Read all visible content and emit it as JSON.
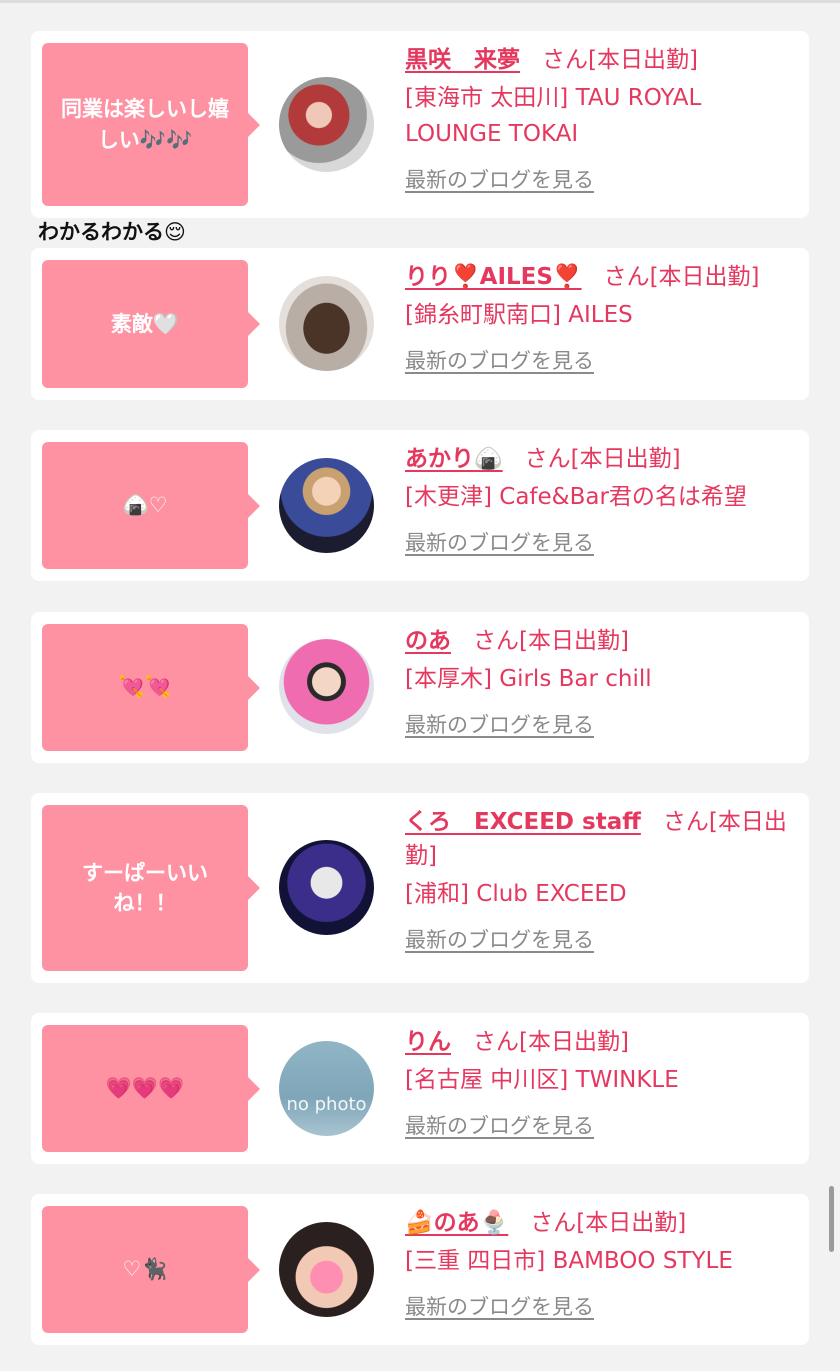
{
  "cards": [
    {
      "message": "同業は楽しいし嬉しい🎶🎶",
      "name": "黒咲　来夢",
      "suffix": "さん[本日出勤]",
      "location": "[東海市 太田川] TAU ROYAL LOUNGE TOKAI",
      "blog_link": "最新のブログを見る"
    },
    {
      "message": "素敵🤍",
      "name": "りり❣️AILES❣️",
      "suffix": "さん[本日出勤]",
      "location": "[錦糸町駅南口] AILES",
      "blog_link": "最新のブログを見る"
    },
    {
      "message": "🍙♡",
      "name": "あかり🍙",
      "suffix": "さん[本日出勤]",
      "location": "[木更津] Cafe&Bar君の名は希望",
      "blog_link": "最新のブログを見る"
    },
    {
      "message": "💘💘",
      "name": "のあ",
      "suffix": "さん[本日出勤]",
      "location": "[本厚木] Girls Bar chill",
      "blog_link": "最新のブログを見る"
    },
    {
      "message": "すーぱーいいね！！",
      "name": "くろ　EXCEED staff",
      "suffix": "さん[本日出勤]",
      "location": "[浦和] Club EXCEED",
      "blog_link": "最新のブログを見る"
    },
    {
      "message": "💗💗💗",
      "name": "りん",
      "suffix": "さん[本日出勤]",
      "location": "[名古屋 中川区] TWINKLE",
      "blog_link": "最新のブログを見る",
      "avatar_text": "no photo"
    },
    {
      "message": "♡🐈‍⬛",
      "name": "🍰のあ🍨",
      "suffix": "さん[本日出勤]",
      "location": "[三重 四日市] BAMBOO STYLE",
      "blog_link": "最新のブログを見る"
    }
  ],
  "reply_comment": "わかるわかる😌",
  "colors": {
    "bubble": "#fe92a2",
    "name": "#e5385f",
    "background": "#f2f2f2",
    "blog_link": "#8a8a8a"
  }
}
